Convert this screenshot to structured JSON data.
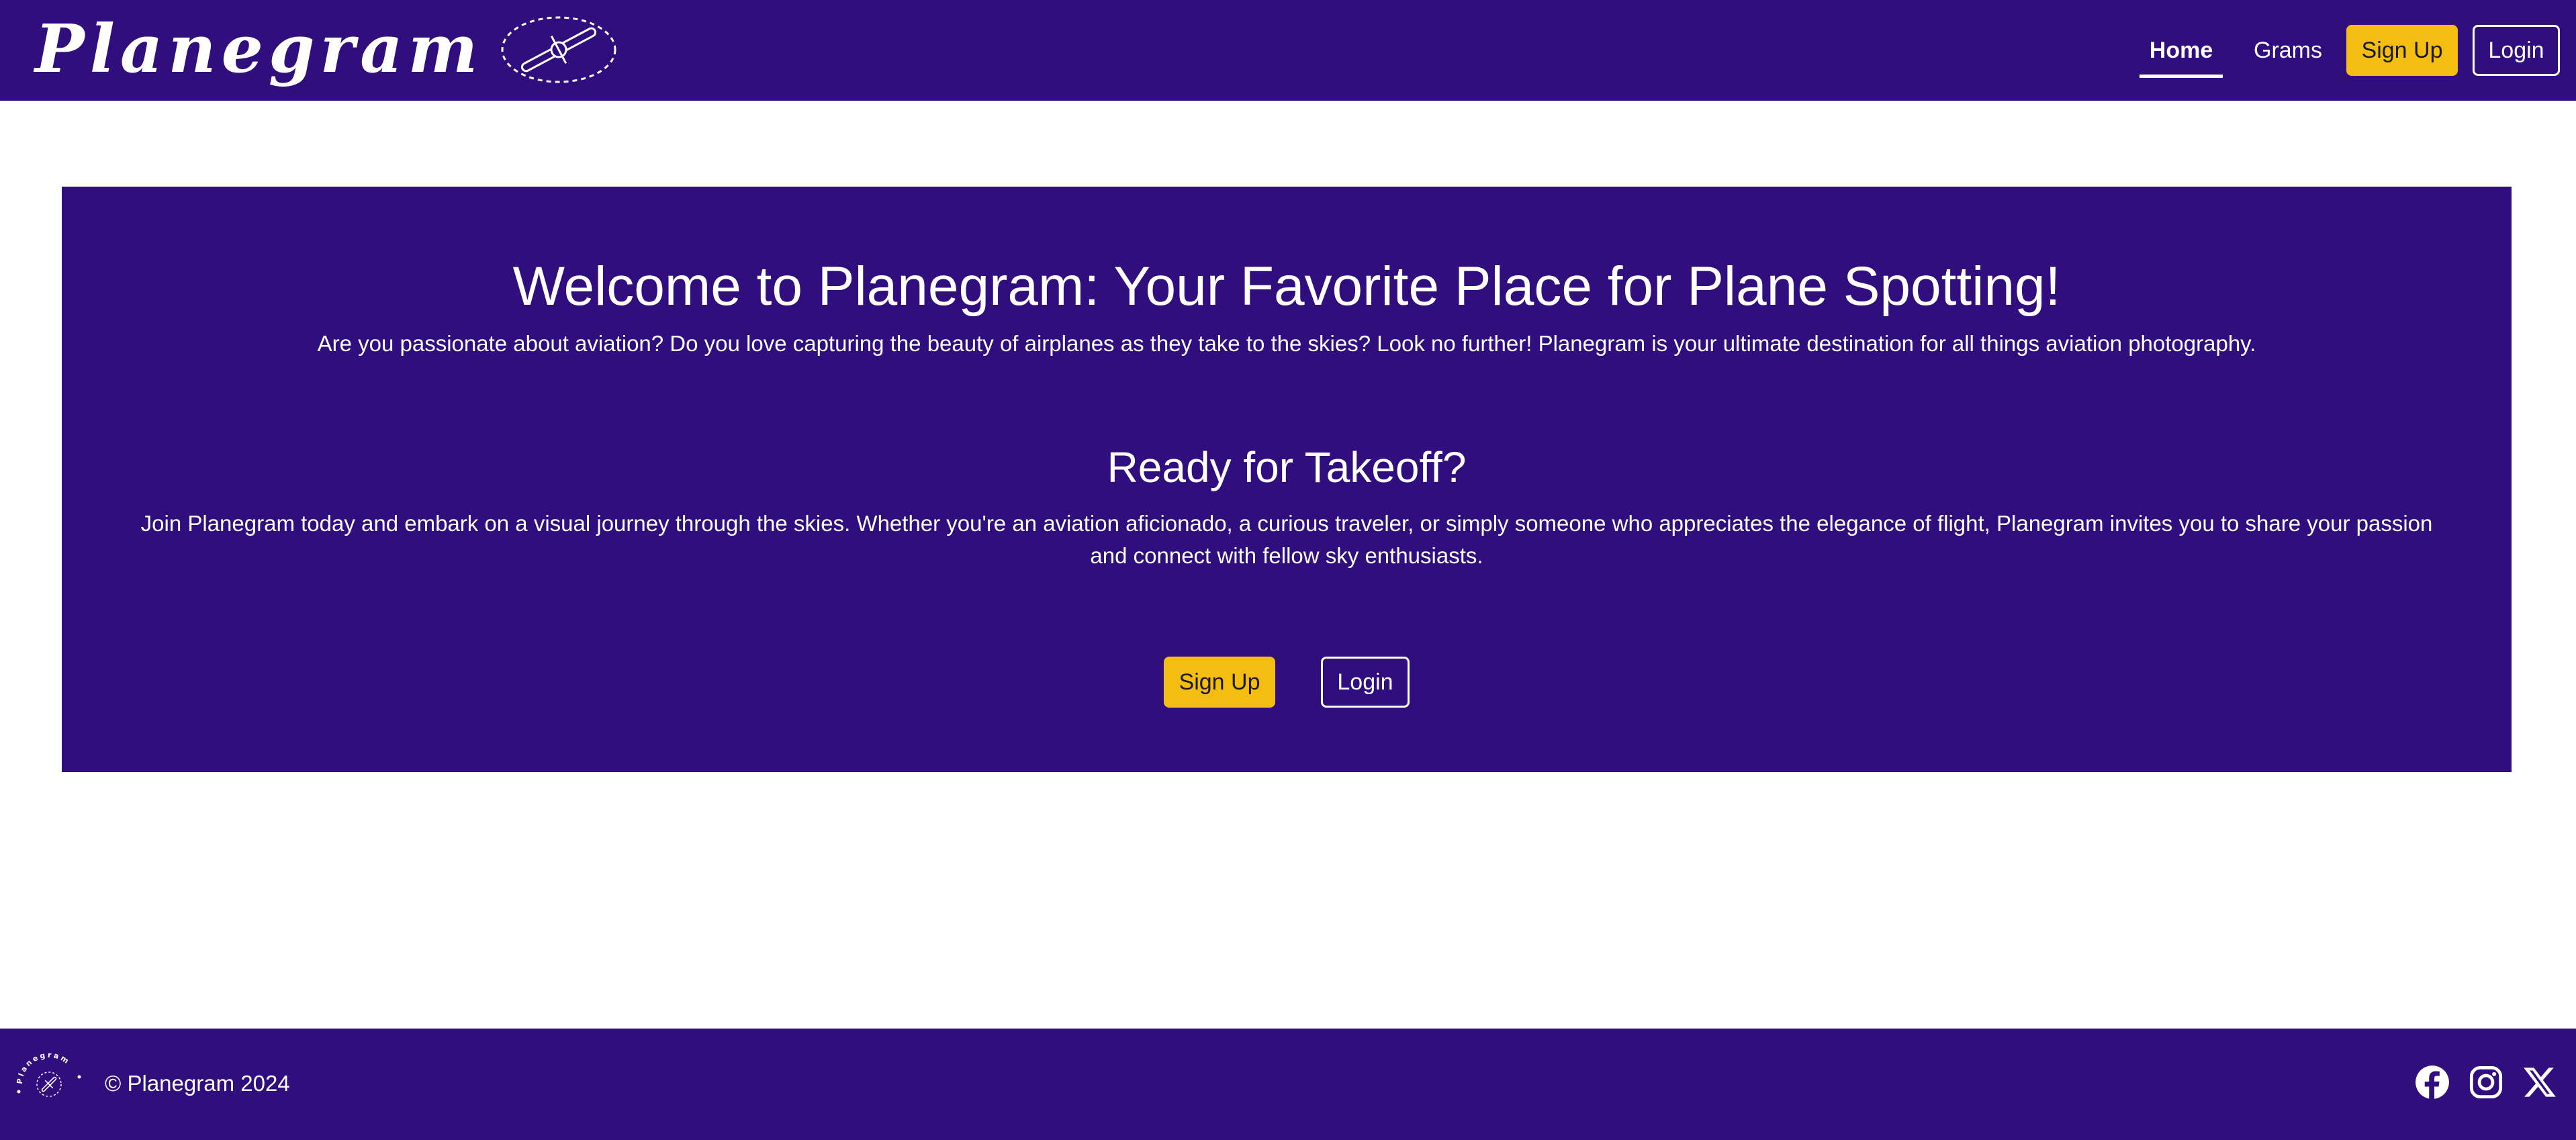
{
  "navbar": {
    "brand": "Planegram",
    "links": {
      "home": "Home",
      "grams": "Grams"
    },
    "signup_label": "Sign Up",
    "login_label": "Login"
  },
  "hero": {
    "title": "Welcome to Planegram: Your Favorite Place for Plane Spotting!",
    "intro": "Are you passionate about aviation? Do you love capturing the beauty of airplanes as they take to the skies? Look no further! Planegram is your ultimate destination for all things aviation photography.",
    "subtitle": "Ready for Takeoff?",
    "body": "Join Planegram today and embark on a visual journey through the skies. Whether you're an aviation aficionado, a curious traveler, or simply someone who appreciates the elegance of flight, Planegram invites you to share your passion and connect with fellow sky enthusiasts.",
    "signup_label": "Sign Up",
    "login_label": "Login"
  },
  "footer": {
    "logo_text": "Planegram",
    "copyright": "© Planegram 2024",
    "social": [
      "facebook-icon",
      "instagram-icon",
      "x-icon"
    ]
  },
  "colors": {
    "brand_purple": "#310e7d",
    "accent_yellow": "#f4bd12",
    "white": "#ffffff"
  }
}
